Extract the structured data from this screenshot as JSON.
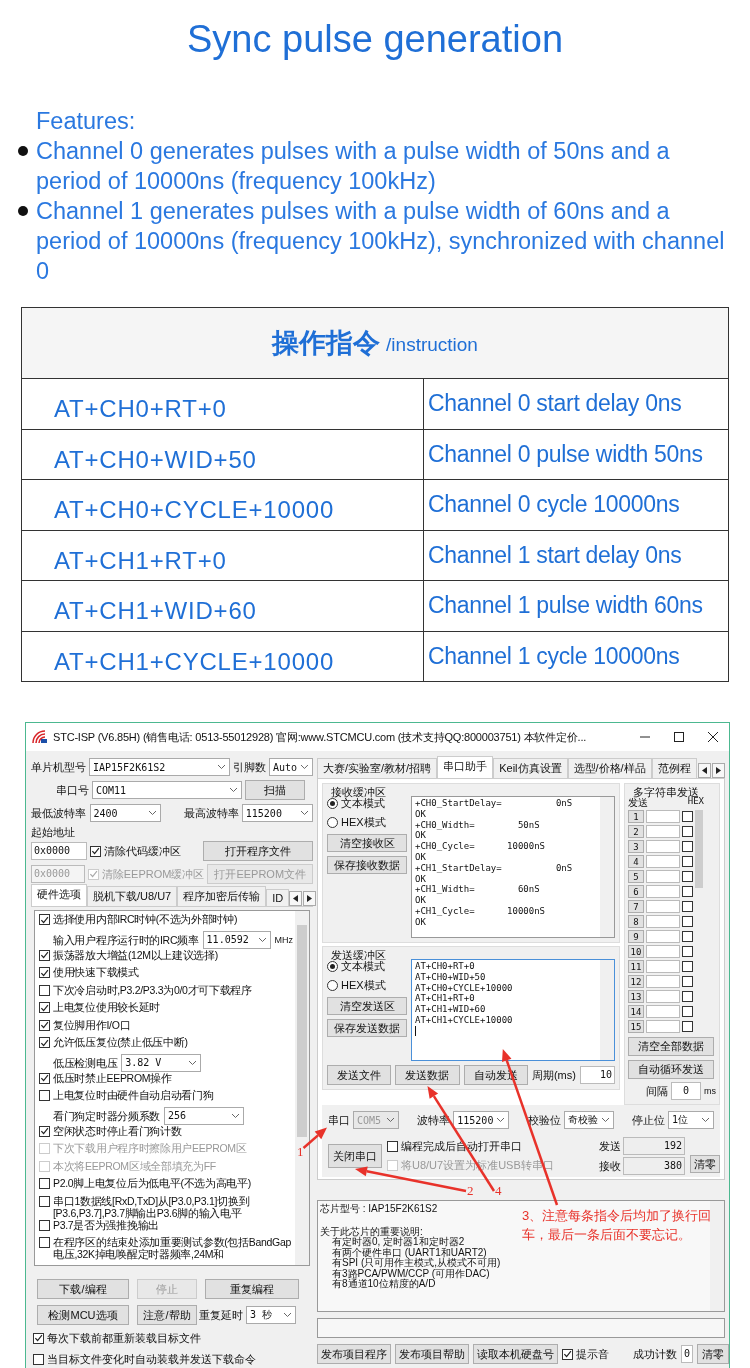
{
  "page_title": "Sync pulse generation",
  "features": {
    "heading": "Features:",
    "items": [
      "Channel 0 generates pulses with a pulse width of 50ns and a period of 10000ns (frequency 100kHz)",
      "Channel 1 generates pulses with a pulse width of 60ns and a period of 10000ns (frequency 100kHz), synchronized with channel 0"
    ]
  },
  "instruction_table": {
    "heading": "操作指令",
    "subheading": "/instruction",
    "rows": [
      {
        "command": "AT+CH0+RT+0",
        "description": "Channel 0 start delay 0ns"
      },
      {
        "command": "AT+CH0+WID+50",
        "description": "Channel 0 pulse width 50ns"
      },
      {
        "command": "AT+CH0+CYCLE+10000",
        "description": "Channel 0 cycle 10000ns"
      },
      {
        "command": "AT+CH1+RT+0",
        "description": "Channel 1 start delay 0ns"
      },
      {
        "command": "AT+CH1+WID+60",
        "description": "Channel 1 pulse width 60ns"
      },
      {
        "command": "AT+CH1+CYCLE+10000",
        "description": "Channel 1 cycle 10000ns"
      }
    ]
  },
  "app_window": {
    "title": "STC-ISP (V6.85H) (销售电话: 0513-55012928) 官网:www.STCMCU.com  (技术支持QQ:800003751) 本软件定价...",
    "mcu_model": {
      "label": "单片机型号",
      "value": "IAP15F2K61S2"
    },
    "pin_count": {
      "label": "引脚数",
      "value": "Auto"
    },
    "serial_port": {
      "label": "串口号",
      "value": "COM11",
      "button": "扫描"
    },
    "min_baud": {
      "label": "最低波特率",
      "value": "2400"
    },
    "max_baud": {
      "label": "最高波特率",
      "value": "115200"
    },
    "start_address": {
      "label": "起始地址",
      "rows": [
        {
          "value": "0x0000",
          "disabled": false,
          "option": "清除代码缓冲区",
          "checked": true,
          "button": "打开程序文件"
        },
        {
          "value": "0x0000",
          "disabled": true,
          "option": "清除EEPROM缓冲区",
          "checked": true,
          "button": "打开EEPROM文件"
        }
      ]
    },
    "left_tabs": [
      {
        "label": "硬件选项",
        "selected": true
      },
      {
        "label": "脱机下载/U8/U7",
        "selected": false
      },
      {
        "label": "程序加密后传输",
        "selected": false
      },
      {
        "label": "ID",
        "selected": false
      }
    ],
    "hardware_options": [
      {
        "kind": "checkbox",
        "label": "选择使用内部IRC时钟(不选为外部时钟)",
        "checked": true,
        "disabled": false
      },
      {
        "kind": "select",
        "label": "输入用户程序运行时的IRC频率",
        "value": "11.0592",
        "unit": "MHz"
      },
      {
        "kind": "checkbox",
        "label": "振荡器放大增益(12M以上建议选择)",
        "checked": true,
        "disabled": false
      },
      {
        "kind": "checkbox",
        "label": "使用快速下载模式",
        "checked": true,
        "disabled": false
      },
      {
        "kind": "checkbox",
        "label": "下次冷启动时,P3.2/P3.3为0/0才可下载程序",
        "checked": false,
        "disabled": false
      },
      {
        "kind": "checkbox",
        "label": "上电复位使用较长延时",
        "checked": true,
        "disabled": false
      },
      {
        "kind": "checkbox",
        "label": "复位脚用作I/O口",
        "checked": true,
        "disabled": false
      },
      {
        "kind": "checkbox",
        "label": "允许低压复位(禁止低压中断)",
        "checked": true,
        "disabled": false
      },
      {
        "kind": "select",
        "label": "低压检测电压",
        "value": "3.82 V"
      },
      {
        "kind": "checkbox",
        "label": "低压时禁止EEPROM操作",
        "checked": true,
        "disabled": false
      },
      {
        "kind": "checkbox",
        "label": "上电复位时由硬件自动启动看门狗",
        "checked": false,
        "disabled": false
      },
      {
        "kind": "select",
        "label": "看门狗定时器分频系数",
        "value": "256"
      },
      {
        "kind": "checkbox",
        "label": "空闲状态时停止看门狗计数",
        "checked": true,
        "disabled": false
      },
      {
        "kind": "checkbox",
        "label": "下次下载用户程序时擦除用户EEPROM区",
        "checked": false,
        "disabled": true
      },
      {
        "kind": "checkbox",
        "label": "本次将EEPROM区域全部填充为FF",
        "checked": false,
        "disabled": true
      },
      {
        "kind": "checkbox",
        "label": "P2.0脚上电复位后为低电平(不选为高电平)",
        "checked": false,
        "disabled": false
      },
      {
        "kind": "checkbox",
        "label": "串口1数据线[RxD,TxD]从[P3.0,P3.1]切换到[P3.6,P3.7],P3.7脚输出P3.6脚的输入电平",
        "checked": false,
        "disabled": false
      },
      {
        "kind": "checkbox",
        "label": "P3.7是否为强推挽输出",
        "checked": false,
        "disabled": false
      },
      {
        "kind": "checkbox",
        "label": "在程序区的结束处添加重要测试参数(包括BandGap电压,32K掉电唤醒定时器频率,24M和",
        "checked": false,
        "disabled": false
      }
    ],
    "left_buttons": [
      {
        "label": "下载/编程",
        "disabled": false
      },
      {
        "label": "停止",
        "disabled": true
      },
      {
        "label": "重复编程",
        "disabled": false
      },
      {
        "label": "检测MCU选项",
        "disabled": false
      },
      {
        "label": "注意/帮助",
        "disabled": false
      }
    ],
    "repeat_delay": {
      "label": "重复延时",
      "value": "3 秒"
    },
    "left_checkboxes": [
      {
        "label": "每次下载前都重新装载目标文件",
        "checked": true
      },
      {
        "label": "当目标文件变化时自动装载并发送下载命令",
        "checked": false
      }
    ],
    "right_tabs": [
      {
        "label": "大赛/实验室/教材/招聘",
        "selected": false
      },
      {
        "label": "串口助手",
        "selected": true
      },
      {
        "label": "Keil仿真设置",
        "selected": false
      },
      {
        "label": "选型/价格/样品",
        "selected": false
      },
      {
        "label": "范例程",
        "selected": false
      }
    ],
    "receive_buffer": {
      "title": "接收缓冲区",
      "modes": [
        {
          "label": "文本模式",
          "selected": true
        },
        {
          "label": "HEX模式",
          "selected": false
        }
      ],
      "buttons": [
        "清空接收区",
        "保存接收数据"
      ],
      "lines": [
        "+CH0_StartDelay=          0nS",
        "OK",
        "+CH0_Width=        50nS",
        "OK",
        "+CH0_Cycle=      10000nS",
        "OK",
        "+CH1_StartDelay=          0nS",
        "OK",
        "+CH1_Width=        60nS",
        "OK",
        "+CH1_Cycle=      10000nS",
        "OK"
      ]
    },
    "multi_send": {
      "title": "多字符串发送",
      "send_header": "发送",
      "hex_header": "HEX",
      "rows": [
        {
          "number": "1",
          "hex": false
        },
        {
          "number": "2",
          "hex": false
        },
        {
          "number": "3",
          "hex": false
        },
        {
          "number": "4",
          "hex": false
        },
        {
          "number": "5",
          "hex": false
        },
        {
          "number": "6",
          "hex": false
        },
        {
          "number": "7",
          "hex": false
        },
        {
          "number": "8",
          "hex": false
        },
        {
          "number": "9",
          "hex": false
        },
        {
          "number": "10",
          "hex": false
        },
        {
          "number": "11",
          "hex": false
        },
        {
          "number": "12",
          "hex": false
        },
        {
          "number": "13",
          "hex": false
        },
        {
          "number": "14",
          "hex": false
        },
        {
          "number": "15",
          "hex": false
        }
      ],
      "buttons": [
        "清空全部数据",
        "自动循环发送"
      ],
      "interval": {
        "label": "间隔",
        "value": "0",
        "unit": "ms"
      }
    },
    "send_buffer": {
      "title": "发送缓冲区",
      "modes": [
        {
          "label": "文本模式",
          "selected": true
        },
        {
          "label": "HEX模式",
          "selected": false
        }
      ],
      "buttons": [
        "清空发送区",
        "保存发送数据"
      ],
      "lines": [
        "AT+CH0+RT+0",
        "AT+CH0+WID+50",
        "AT+CH0+CYCLE+10000",
        "AT+CH1+RT+0",
        "AT+CH1+WID+60",
        "AT+CH1+CYCLE+10000"
      ],
      "actions": [
        "发送文件",
        "发送数据",
        "自动发送"
      ],
      "period": {
        "label": "周期(ms)",
        "value": "10"
      }
    },
    "port_settings": [
      {
        "label": "串口",
        "value": "COM5",
        "disabled": true
      },
      {
        "label": "波特率",
        "value": "115200",
        "disabled": false
      },
      {
        "label": "校验位",
        "value": "奇校验",
        "disabled": false
      },
      {
        "label": "停止位",
        "value": "1位",
        "disabled": false
      }
    ],
    "close_port_button": "关闭串口",
    "port_options": [
      {
        "label": "编程完成后自动打开串口",
        "checked": false,
        "disabled": false
      },
      {
        "label": "将U8/U7设置为标准USB转串口",
        "checked": false,
        "disabled": true
      }
    ],
    "counters": [
      {
        "label": "发送",
        "value": "192"
      },
      {
        "label": "接收",
        "value": "380"
      }
    ],
    "counter_clear_button": "清零",
    "chip_info": {
      "model_line": "芯片型号 : IAP15F2K61S2",
      "notes_title": "关于此芯片的重要说明:",
      "notes": [
        "有定时器0, 定时器1和定时器2",
        "有两个硬件串口 (UART1和UART2)",
        "有SPI (只可用作主模式,从模式不可用)",
        "有3路PCA/PWM/CCP (可用作DAC)",
        "有8通道10位精度的A/D"
      ]
    },
    "bottom_buttons": [
      "发布项目程序",
      "发布项目帮助",
      "读取本机硬盘号"
    ],
    "sound_option": {
      "label": "提示音",
      "checked": true
    },
    "success_count": {
      "label": "成功计数",
      "value": "0",
      "button": "清零"
    },
    "annotations": [
      {
        "label": "1"
      },
      {
        "label": "2"
      },
      {
        "label": "3、注意每条指令后均加了换行回车，最后一条后面不要忘记。"
      },
      {
        "label": "4"
      }
    ]
  }
}
